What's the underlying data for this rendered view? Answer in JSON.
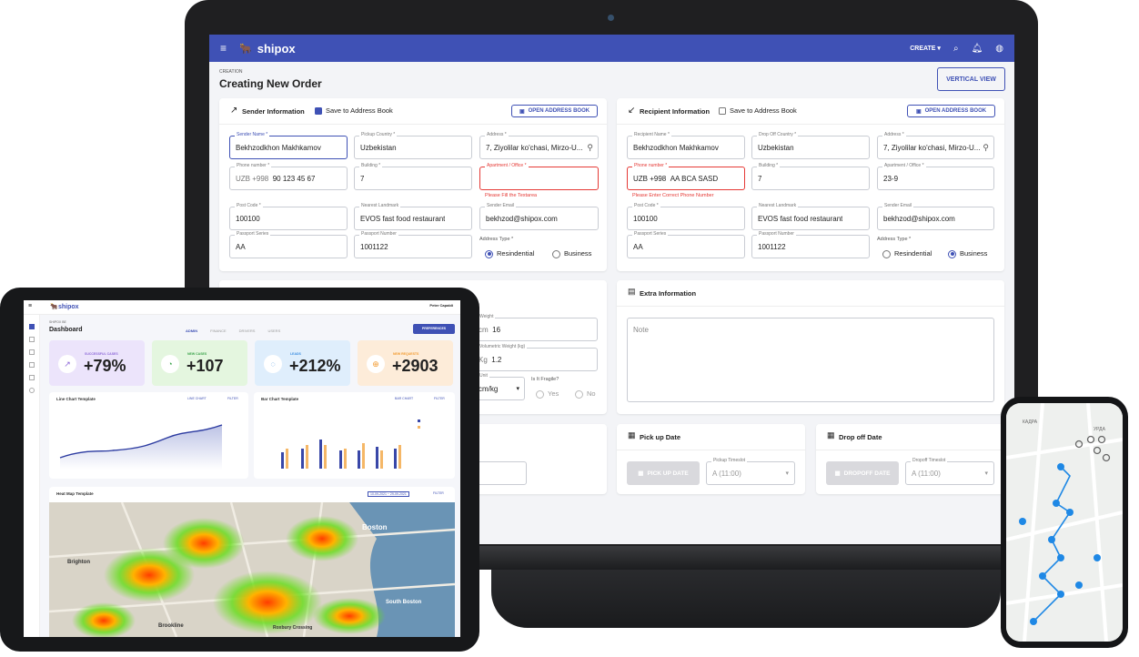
{
  "app": {
    "brand": "shipox",
    "create_label": "CREATE",
    "breadcrumb": "CREATION",
    "page_title": "Creating New Order",
    "vertical_view_label": "VERTICAL VIEW"
  },
  "sender": {
    "title": "Sender Information",
    "save_label": "Save to Address Book",
    "open_book_label": "OPEN ADDRESS BOOK",
    "name_label": "Sender Name *",
    "name_value": "Bekhzodkhon Makhkamov",
    "country_label": "Pickup Country *",
    "country_value": "Uzbekistan",
    "address_label": "Address *",
    "address_value": "7, Ziyolilar ko'chasi, Mirzo-U...",
    "phone_label": "Phone number *",
    "phone_prefix": "UZB +998",
    "phone_value": "90 123 45 67",
    "building_label": "Building *",
    "building_value": "7",
    "apartment_label": "Apartment / Office *",
    "apartment_value": "",
    "apartment_error": "Please Fill the Textarea",
    "post_label": "Post Code *",
    "post_value": "100100",
    "landmark_label": "Nearest Landmark",
    "landmark_value": "EVOS fast food restaurant",
    "email_label": "Sender Email",
    "email_value": "bekhzod@shipox.com",
    "passport_series_label": "Passport Series",
    "passport_series_value": "AA",
    "passport_number_label": "Passport Number",
    "passport_number_value": "1001122",
    "address_type_label": "Address Type *",
    "residential_label": "Resindential",
    "business_label": "Business"
  },
  "recipient": {
    "title": "Recipient Information",
    "save_label": "Save to Address Book",
    "open_book_label": "OPEN ADDRESS BOOK",
    "name_label": "Recipient Name *",
    "name_value": "Bekhzodkhon Makhkamov",
    "country_label": "Drop Off Country *",
    "country_value": "Uzbekistan",
    "address_label": "Address *",
    "address_value": "7, Ziyolilar ko'chasi, Mirzo-U...",
    "phone_label": "Phone number *",
    "phone_prefix": "UZB +998",
    "phone_value": "AA BCA SASD",
    "phone_error": "Please Enter Correct Phone Number",
    "building_label": "Building *",
    "building_value": "7",
    "apartment_label": "Apartment / Office *",
    "apartment_value": "23-9",
    "post_label": "Post Code *",
    "post_value": "100100",
    "landmark_label": "Nearest Landmark",
    "landmark_value": "EVOS fast food restaurant",
    "email_label": "Sender Email",
    "email_value": "bekhzod@shipox.com",
    "passport_series_label": "Passport Series",
    "passport_series_value": "AA",
    "passport_number_label": "Passport Number",
    "passport_number_value": "1001122",
    "address_type_label": "Address Type *",
    "residential_label": "Resindential",
    "business_label": "Business"
  },
  "package": {
    "weight_label": "Weight",
    "weight_unit": "cm",
    "weight_value": "16",
    "volumetric_label": "Volumetric Weight (kg)",
    "volumetric_unit": "Kg",
    "volumetric_value": "1.2",
    "unit_label": "Unit",
    "unit_value": "cm/kg",
    "fragile_label": "Is It Fragile?",
    "yes_label": "Yes",
    "no_label": "No"
  },
  "extra": {
    "title": "Extra Information",
    "note_placeholder": "Note"
  },
  "pickup": {
    "title": "Pick up Date",
    "button": "PICK UP DATE",
    "timeslot_label": "Pickup Timeslot",
    "timeslot_value": "A (11:00)"
  },
  "dropoff": {
    "title": "Drop off Date",
    "button": "DROPOFF DATE",
    "timeslot_label": "Dropoff Timeslot",
    "timeslot_value": "A (11:00)"
  },
  "tablet": {
    "brand": "shipox",
    "user_name": "Peter Capaldi",
    "breadcrumb": "SHIPOX BE",
    "title": "Dashboard",
    "tabs": [
      "ADMIN",
      "FINANCE",
      "DRIVERS",
      "USERS"
    ],
    "preferences": "PREFERENCES",
    "stats": [
      {
        "caption": "SUCCESSFUL CASES",
        "value": "+79%",
        "color": "#e9e1fb",
        "accent": "#8e6ad8",
        "icon": "↗"
      },
      {
        "caption": "NEW CASES",
        "value": "+107",
        "color": "#e4f6df",
        "accent": "#3aa34a",
        "icon": "◔"
      },
      {
        "caption": "LEADS",
        "value": "+212%",
        "color": "#dfeefc",
        "accent": "#3c8ee0",
        "icon": "◌"
      },
      {
        "caption": "NEW REQUESTS",
        "value": "+2903",
        "color": "#fdecd9",
        "accent": "#f29a2e",
        "icon": "⊕"
      }
    ],
    "line_title": "Line Chart Template",
    "line_toggle": "LINE CHART",
    "bar_title": "Bar Chart Template",
    "bar_toggle": "BAR CHART",
    "filter": "FILTER",
    "heat_title": "Heat Map Template",
    "heat_range": "10-09-2021 ~ 29-09-2021",
    "map_labels": [
      "Boston",
      "Brighton",
      "Brookline",
      "South Boston",
      "Roxbury Crossing"
    ]
  },
  "phone": {
    "map_labels": [
      "КАДРА",
      "УРДА"
    ]
  }
}
